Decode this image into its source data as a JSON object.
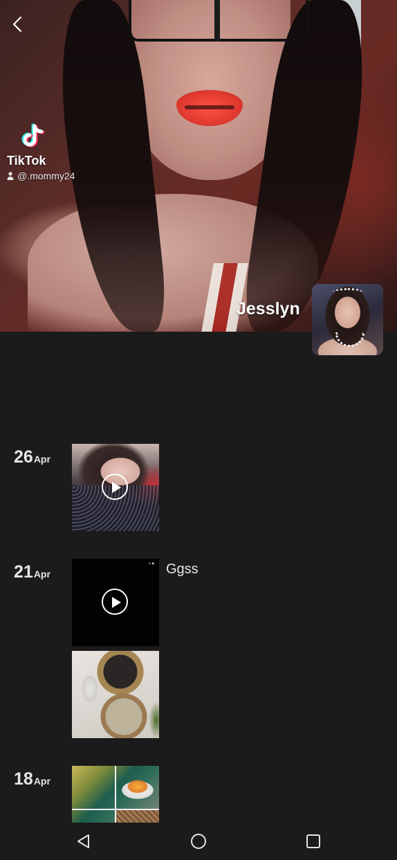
{
  "header": {
    "watermark": {
      "brand": "TikTok",
      "handle": "@.mommy24"
    },
    "profile_name": "Jesslyn"
  },
  "timeline": [
    {
      "day": "26",
      "month": "Apr"
    },
    {
      "day": "21",
      "month": "Apr",
      "caption": "Ggss"
    },
    {
      "day": "18",
      "month": "Apr"
    }
  ],
  "icons": {
    "back": "chevron-left-icon",
    "play": "play-icon",
    "nav_back": "triangle-back-icon",
    "nav_home": "circle-home-icon",
    "nav_recents": "square-recents-icon"
  },
  "colors": {
    "background": "#1b1b1b",
    "text": "#e6e6e6",
    "tiktok_cyan": "#25f4ee",
    "tiktok_red": "#fe2c55"
  }
}
